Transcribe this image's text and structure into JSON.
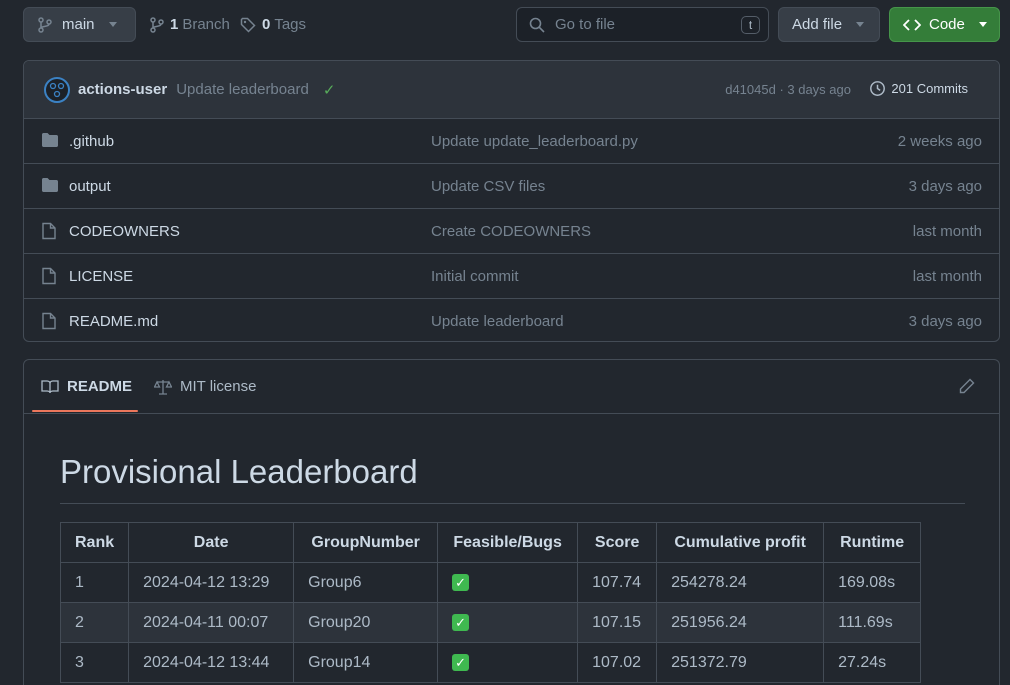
{
  "topbar": {
    "branch": "main",
    "branches_count": "1",
    "branches_label": "Branch",
    "tags_count": "0",
    "tags_label": "Tags",
    "search_placeholder": "Go to file",
    "search_shortcut": "t",
    "add_file": "Add file",
    "code": "Code"
  },
  "commit": {
    "user": "actions-user",
    "message": "Update leaderboard",
    "sha_time": "d41045d · 3 days ago",
    "commits": "201 Commits"
  },
  "files": [
    {
      "type": "folder",
      "name": ".github",
      "message": "Update update_leaderboard.py",
      "date": "2 weeks ago"
    },
    {
      "type": "folder",
      "name": "output",
      "message": "Update CSV files",
      "date": "3 days ago"
    },
    {
      "type": "file",
      "name": "CODEOWNERS",
      "message": "Create CODEOWNERS",
      "date": "last month"
    },
    {
      "type": "file",
      "name": "LICENSE",
      "message": "Initial commit",
      "date": "last month"
    },
    {
      "type": "file",
      "name": "README.md",
      "message": "Update leaderboard",
      "date": "3 days ago"
    }
  ],
  "readme": {
    "tab_readme": "README",
    "tab_license": "MIT license",
    "title": "Provisional Leaderboard",
    "columns": [
      "Rank",
      "Date",
      "GroupNumber",
      "Feasible/Bugs",
      "Score",
      "Cumulative profit",
      "Runtime"
    ],
    "rows": [
      {
        "rank": "1",
        "date": "2024-04-12 13:29",
        "group": "Group6",
        "feasible": "✓",
        "score": "107.74",
        "profit": "254278.24",
        "runtime": "169.08s"
      },
      {
        "rank": "2",
        "date": "2024-04-11 00:07",
        "group": "Group20",
        "feasible": "✓",
        "score": "107.15",
        "profit": "251956.24",
        "runtime": "111.69s"
      },
      {
        "rank": "3",
        "date": "2024-04-12 13:44",
        "group": "Group14",
        "feasible": "✓",
        "score": "107.02",
        "profit": "251372.79",
        "runtime": "27.24s"
      }
    ]
  },
  "colors": {
    "background": "#22272e",
    "code_button": "#347d39",
    "check": "#3fb950",
    "tab_underline": "#ec775c"
  }
}
